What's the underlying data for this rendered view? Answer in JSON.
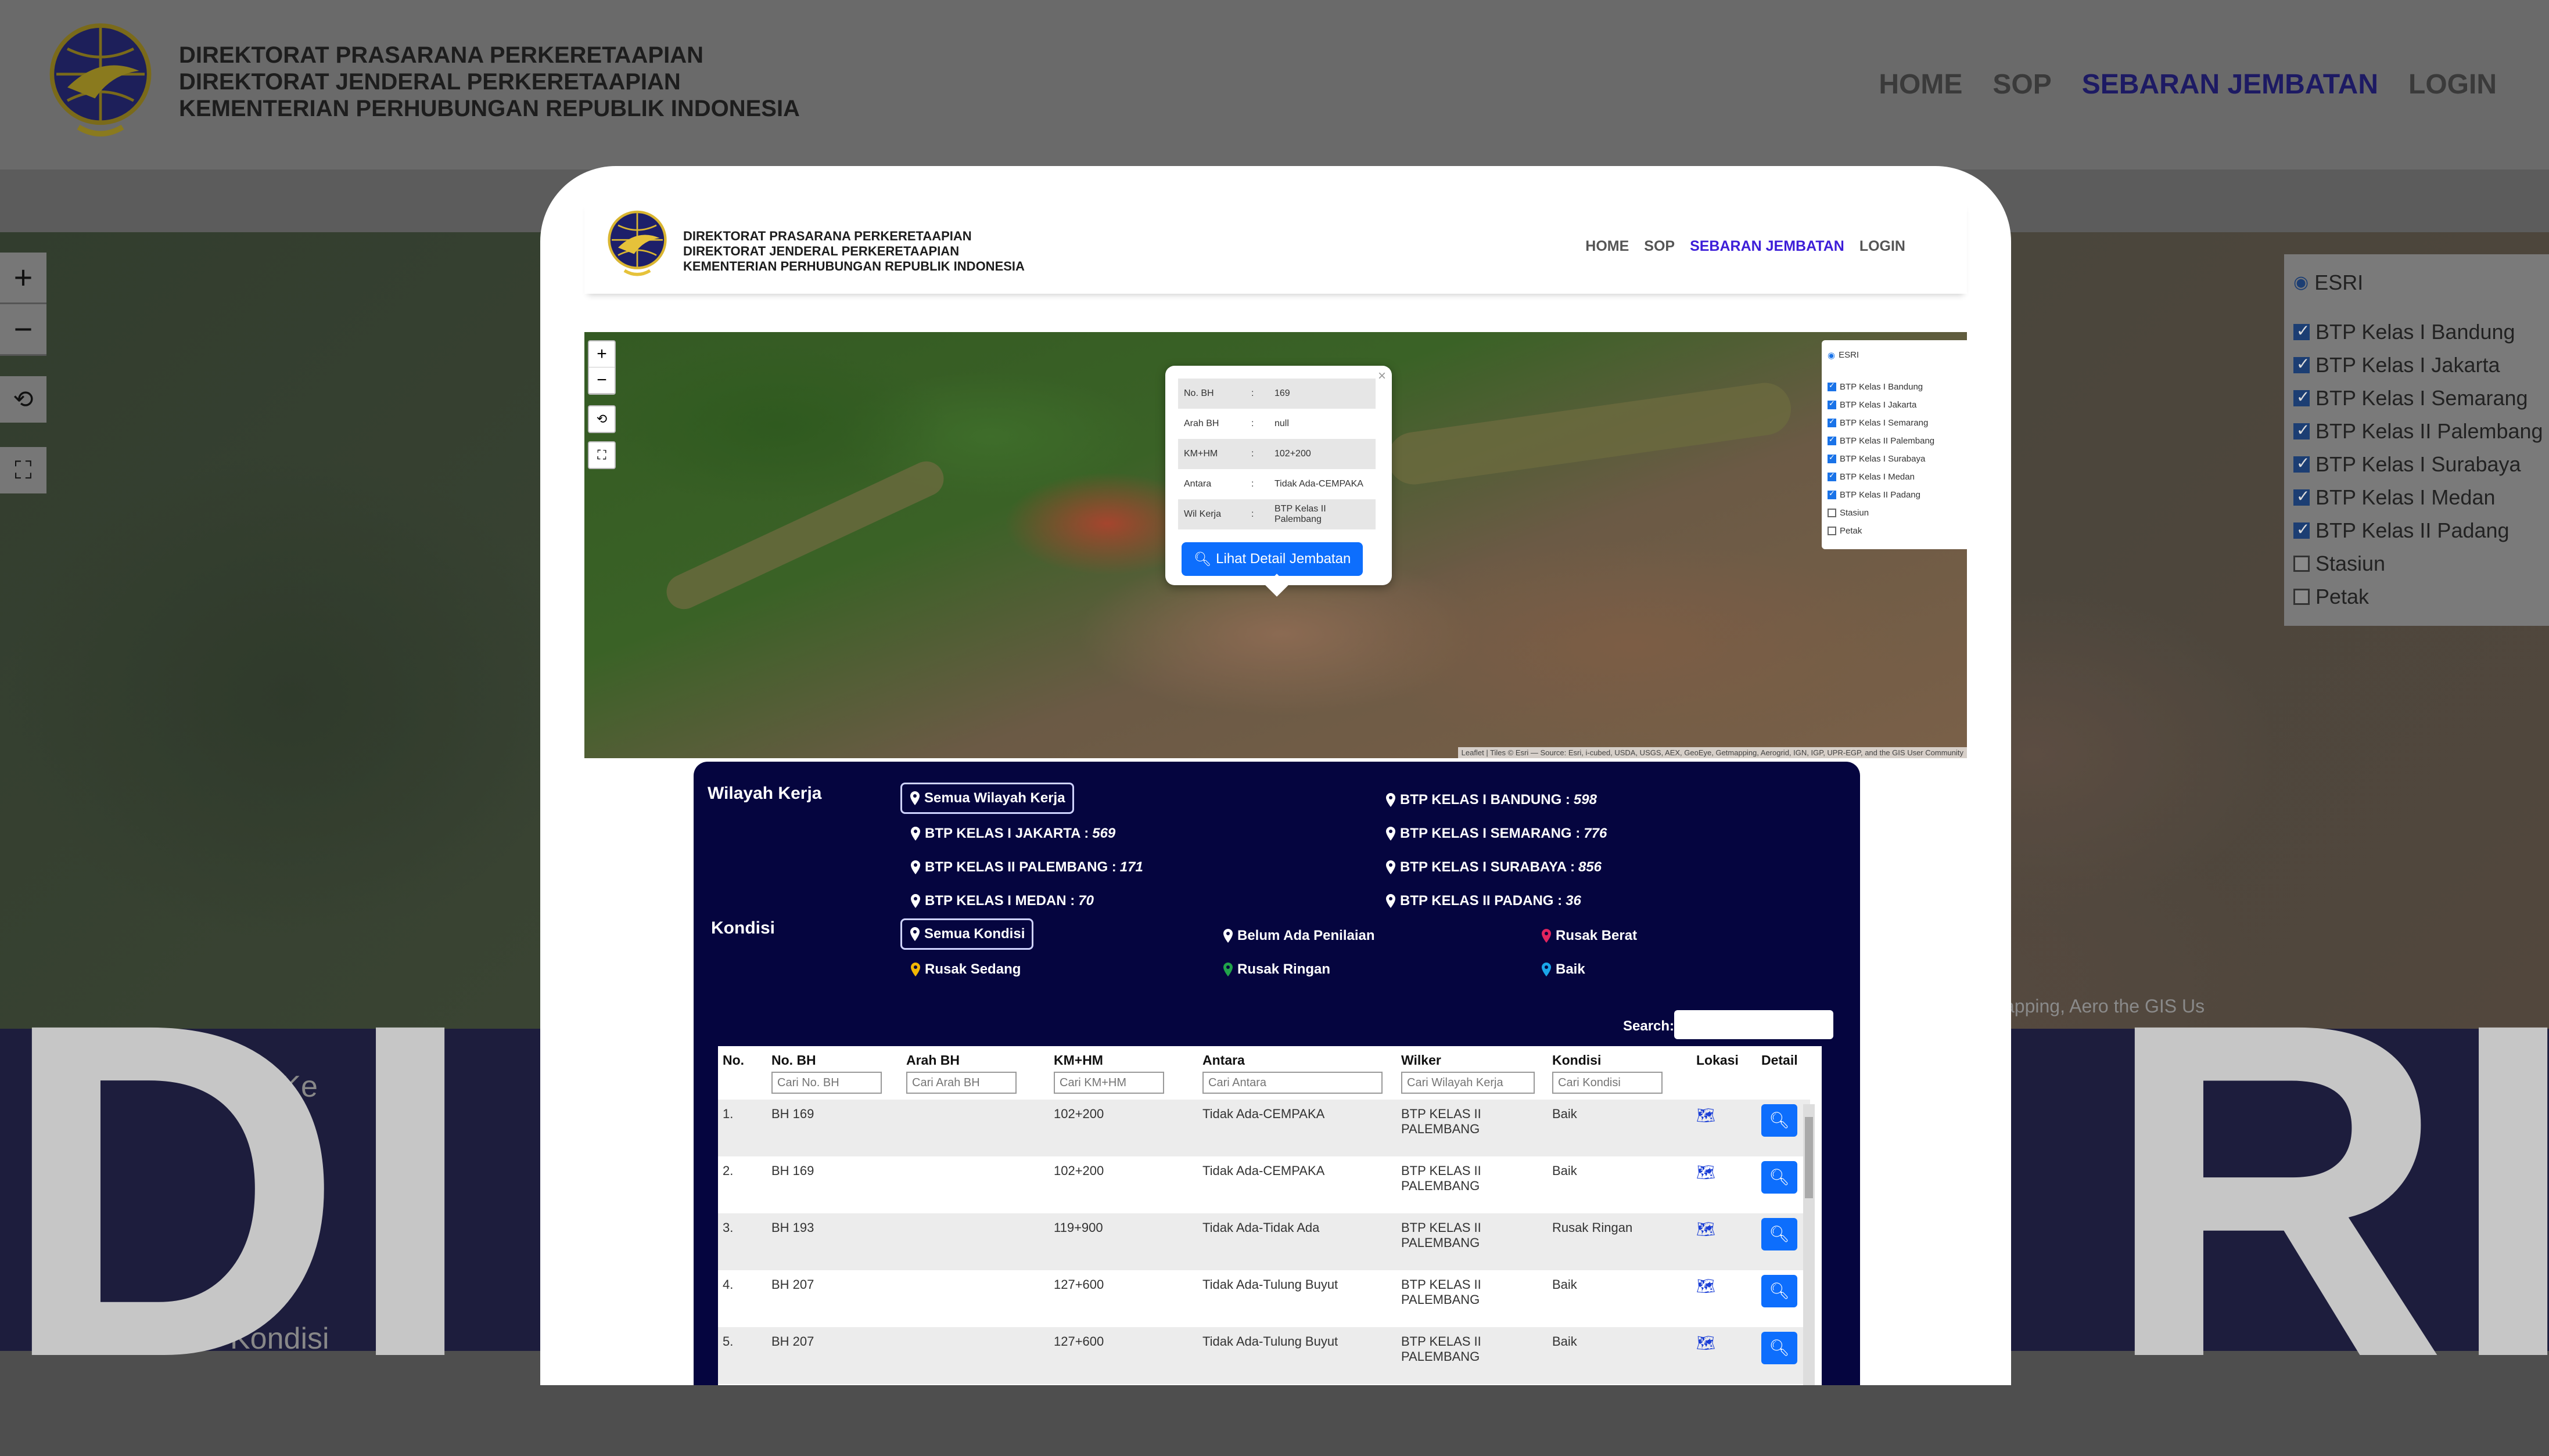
{
  "org": {
    "line1": "DIREKTORAT PRASARANA PERKERETAAPIAN",
    "line2": "DIREKTORAT JENDERAL PERKERETAAPIAN",
    "line3": "KEMENTERIAN PERHUBUNGAN REPUBLIK INDONESIA"
  },
  "nav": {
    "home": "HOME",
    "sop": "SOP",
    "sebaran": "SEBARAN JEMBATAN",
    "login": "LOGIN"
  },
  "map": {
    "zoom_in": "+",
    "zoom_out": "−",
    "base_layer": "ESRI",
    "layers": [
      {
        "label": "BTP Kelas I Bandung",
        "checked": true
      },
      {
        "label": "BTP Kelas I Jakarta",
        "checked": true
      },
      {
        "label": "BTP Kelas I Semarang",
        "checked": true
      },
      {
        "label": "BTP Kelas II Palembang",
        "checked": true
      },
      {
        "label": "BTP Kelas I Surabaya",
        "checked": true
      },
      {
        "label": "BTP Kelas I Medan",
        "checked": true
      },
      {
        "label": "BTP Kelas II Padang",
        "checked": true
      },
      {
        "label": "Stasiun",
        "checked": false
      },
      {
        "label": "Petak",
        "checked": false
      }
    ],
    "attribution": "Leaflet | Tiles © Esri — Source: Esri, i-cubed, USDA, USGS, AEX, GeoEye, Getmapping, Aerogrid, IGN, IGP, UPR-EGP, and the GIS User Community",
    "bg_attribution": "apping, Aero                      the GIS Us"
  },
  "popup": {
    "rows": [
      {
        "k": "No. BH",
        "v": "169"
      },
      {
        "k": "Arah BH",
        "v": "null"
      },
      {
        "k": "KM+HM",
        "v": "102+200"
      },
      {
        "k": "Antara",
        "v": "Tidak Ada-CEMPAKA"
      },
      {
        "k": "Wil Kerja",
        "v": "BTP Kelas II Palembang"
      }
    ],
    "sep": ":",
    "close": "×",
    "button": "Lihat Detail Jembatan"
  },
  "filters": {
    "wilayah_label": "Wilayah Kerja",
    "kondisi_label": "Kondisi",
    "wilayah": {
      "all": "Semua Wilayah Kerja",
      "bandung": {
        "name": "BTP KELAS I BANDUNG :",
        "count": "598"
      },
      "jakarta": {
        "name": "BTP KELAS I JAKARTA :",
        "count": "569"
      },
      "semarang": {
        "name": "BTP KELAS I SEMARANG :",
        "count": "776"
      },
      "palembang": {
        "name": "BTP KELAS II PALEMBANG :",
        "count": "171"
      },
      "surabaya": {
        "name": "BTP KELAS I SURABAYA :",
        "count": "856"
      },
      "medan": {
        "name": "BTP KELAS I MEDAN :",
        "count": "70"
      },
      "padang": {
        "name": "BTP KELAS II PADANG :",
        "count": "36"
      }
    },
    "kondisi": {
      "all": "Semua Kondisi",
      "belum": "Belum Ada Penilaian",
      "berat": "Rusak Berat",
      "sedang": "Rusak Sedang",
      "ringan": "Rusak Ringan",
      "baik": "Baik"
    },
    "pin_colors": {
      "white": "#ffffff",
      "berat": "#e0245e",
      "sedang": "#f2b705",
      "ringan": "#21a34a",
      "baik": "#1aa6e8"
    }
  },
  "table": {
    "search_label": "Search:",
    "headers": {
      "no": "No.",
      "bh": "No. BH",
      "arah": "Arah BH",
      "kmhm": "KM+HM",
      "antara": "Antara",
      "wilker": "Wilker",
      "kondisi": "Kondisi",
      "lokasi": "Lokasi",
      "detail": "Detail"
    },
    "placeholders": {
      "bh": "Cari No. BH",
      "arah": "Cari Arah BH",
      "kmhm": "Cari KM+HM",
      "antara": "Cari Antara",
      "wilker": "Cari Wilayah Kerja",
      "kondisi": "Cari Kondisi"
    },
    "rows": [
      {
        "no": "1.",
        "bh": "BH 169",
        "arah": "",
        "kmhm": "102+200",
        "antara": "Tidak Ada-CEMPAKA",
        "wilker1": "BTP KELAS II",
        "wilker2": "PALEMBANG",
        "kondisi": "Baik"
      },
      {
        "no": "2.",
        "bh": "BH 169",
        "arah": "",
        "kmhm": "102+200",
        "antara": "Tidak Ada-CEMPAKA",
        "wilker1": "BTP KELAS II",
        "wilker2": "PALEMBANG",
        "kondisi": "Baik"
      },
      {
        "no": "3.",
        "bh": "BH 193",
        "arah": "",
        "kmhm": "119+900",
        "antara": "Tidak Ada-Tidak Ada",
        "wilker1": "BTP KELAS II",
        "wilker2": "PALEMBANG",
        "kondisi": "Rusak Ringan"
      },
      {
        "no": "4.",
        "bh": "BH 207",
        "arah": "",
        "kmhm": "127+600",
        "antara": "Tidak Ada-Tulung Buyut",
        "wilker1": "BTP KELAS II",
        "wilker2": "PALEMBANG",
        "kondisi": "Baik"
      },
      {
        "no": "5.",
        "bh": "BH 207",
        "arah": "",
        "kmhm": "127+600",
        "antara": "Tidak Ada-Tulung Buyut",
        "wilker1": "BTP KELAS II",
        "wilker2": "PALEMBANG",
        "kondisi": "Baik"
      }
    ]
  },
  "background": {
    "section1": "h Ke",
    "section2": "Kondisi",
    "big_left": "DI",
    "big_right": "RI"
  }
}
